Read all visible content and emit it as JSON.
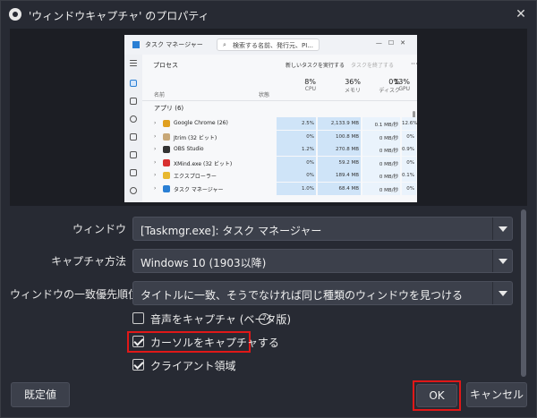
{
  "window": {
    "title": "'ウィンドウキャプチャ' のプロパティ",
    "close_glyph": "✕"
  },
  "preview": {
    "taskmgr": {
      "title": "タスク マネージャー",
      "search_placeholder": "検索する名前、発行元、PI...",
      "window_buttons": "—☐✕",
      "header_title": "プロセス",
      "new_task": "新しいタスクを実行する",
      "end_task": "タスクを終了する",
      "more": "···",
      "col_name": "名前",
      "col_status": "状態",
      "columns": [
        {
          "pct": "8%",
          "label": "CPU"
        },
        {
          "pct": "36%",
          "label": "メモリ"
        },
        {
          "pct": "0%",
          "label": "ディスク"
        },
        {
          "pct": "13%",
          "label": "GPU"
        }
      ],
      "group_label": "アプリ (6)",
      "rows": [
        {
          "name": "Google Chrome (26)",
          "icon_color": "#e0a020",
          "cpu": "2.5%",
          "mem": "2,133.9 MB",
          "disk": "0.1 MB/秒",
          "gpu": "12.6%"
        },
        {
          "name": "Jtrim (32 ビット)",
          "icon_color": "#c8a878",
          "cpu": "0%",
          "mem": "100.8 MB",
          "disk": "0 MB/秒",
          "gpu": "0%"
        },
        {
          "name": "OBS Studio",
          "icon_color": "#333333",
          "cpu": "1.2%",
          "mem": "270.8 MB",
          "disk": "0 MB/秒",
          "gpu": "0.9%"
        },
        {
          "name": "XMind.exe (32 ビット)",
          "icon_color": "#d83030",
          "cpu": "0%",
          "mem": "59.2 MB",
          "disk": "0 MB/秒",
          "gpu": "0%"
        },
        {
          "name": "エクスプローラー",
          "icon_color": "#e8b830",
          "cpu": "0%",
          "mem": "189.4 MB",
          "disk": "0 MB/秒",
          "gpu": "0.1%"
        },
        {
          "name": "タスク マネージャー",
          "icon_color": "#2a7fd4",
          "cpu": "1.0%",
          "mem": "68.4 MB",
          "disk": "0 MB/秒",
          "gpu": "0%"
        }
      ]
    }
  },
  "settings": {
    "window_label": "ウィンドウ",
    "window_value": "[Taskmgr.exe]: タスク マネージャー",
    "capture_method_label": "キャプチャ方法",
    "capture_method_value": "Windows 10 (1903以降)",
    "priority_label": "ウィンドウの一致優先順位",
    "priority_value": "タイトルに一致、そうでなければ同じ種類のウィンドウを見つける",
    "audio_capture_label": "音声をキャプチャ (ベータ版)",
    "audio_capture_checked": false,
    "help_glyph": "?",
    "cursor_capture_label": "カーソルをキャプチャする",
    "cursor_capture_checked": true,
    "client_area_label": "クライアント領域",
    "client_area_checked": true
  },
  "buttons": {
    "defaults": "既定値",
    "ok": "OK",
    "cancel": "キャンセル"
  },
  "colors": {
    "background": "#272a33",
    "control": "#3c404b",
    "highlight": "#e01818"
  }
}
